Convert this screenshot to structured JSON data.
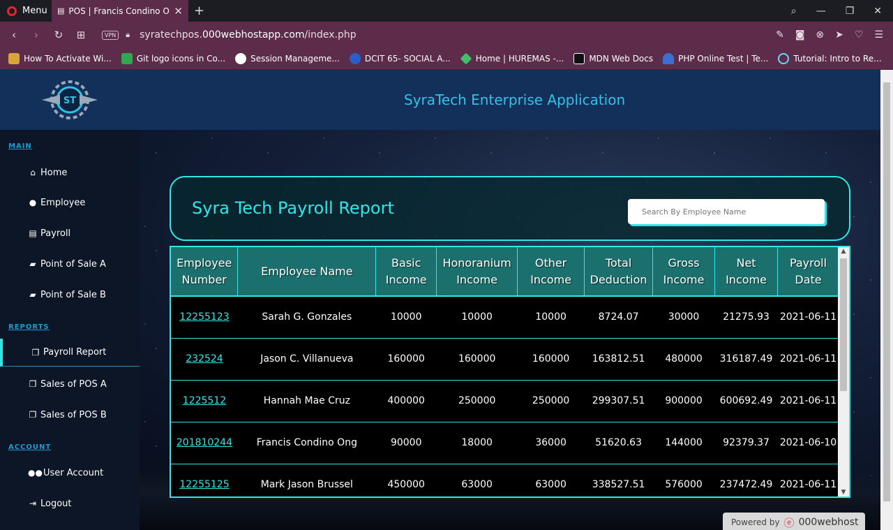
{
  "browser": {
    "menu_label": "Menu",
    "tab_title": "POS | Francis Condino Ong",
    "new_tab": "+",
    "url_prefix": "syratechpos.",
    "url_domain": "000webhostapp.com",
    "url_path": "/index.php",
    "vpn_label": "VPN",
    "bookmarks": [
      {
        "label": "How To Activate Wi...",
        "color": "#d9a43a"
      },
      {
        "label": "Git logo icons in Co...",
        "color": "#2fa84f"
      },
      {
        "label": "Session Manageme...",
        "color": "#ffffff"
      },
      {
        "label": "DCIT 65- SOCIAL A...",
        "color": "#2a5ec9"
      },
      {
        "label": "Home | HUREMAS -...",
        "color": "#3fbf6a"
      },
      {
        "label": "MDN Web Docs",
        "color": "#111111"
      },
      {
        "label": "PHP Online Test | Te...",
        "color": "#3b6fd1"
      },
      {
        "label": "Tutorial: Intro to Re...",
        "color": "#61dafb"
      }
    ]
  },
  "header": {
    "app_title": "SyraTech Enterprise Application"
  },
  "sidebar": {
    "main_title": "MAIN",
    "main_items": [
      {
        "label": "Home",
        "icon": "home-icon"
      },
      {
        "label": "Employee",
        "icon": "user-icon"
      },
      {
        "label": "Payroll",
        "icon": "file-icon"
      },
      {
        "label": "Point of Sale A",
        "icon": "cash-icon"
      },
      {
        "label": "Point of Sale B",
        "icon": "cash-icon"
      }
    ],
    "reports_title": "REPORTS",
    "reports_items": [
      {
        "label": "Payroll Report",
        "icon": "copy-icon"
      },
      {
        "label": "Sales of POS A",
        "icon": "copy-icon"
      },
      {
        "label": "Sales of POS B",
        "icon": "copy-icon"
      }
    ],
    "account_title": "ACCOUNT",
    "account_items": [
      {
        "label": "User Account",
        "icon": "users-icon"
      },
      {
        "label": "Logout",
        "icon": "logout-icon"
      }
    ]
  },
  "report": {
    "title": "Syra Tech Payroll Report",
    "search_placeholder": "Search By Employee Name"
  },
  "table": {
    "headers": [
      [
        "Employee",
        "Number"
      ],
      [
        "Employee Name",
        ""
      ],
      [
        "Basic",
        "Income"
      ],
      [
        "Honoranium",
        "Income"
      ],
      [
        "Other",
        "Income"
      ],
      [
        "Total",
        "Deduction"
      ],
      [
        "Gross",
        "Income"
      ],
      [
        "Net",
        "Income"
      ],
      [
        "Payroll",
        "Date"
      ]
    ],
    "rows": [
      [
        "12255123",
        "Sarah G. Gonzales",
        "10000",
        "10000",
        "10000",
        "8724.07",
        "30000",
        "21275.93",
        "2021-06-11"
      ],
      [
        "232524",
        "Jason C. Villanueva",
        "160000",
        "160000",
        "160000",
        "163812.51",
        "480000",
        "316187.49",
        "2021-06-11"
      ],
      [
        "1225512",
        "Hannah Mae Cruz",
        "400000",
        "250000",
        "250000",
        "299307.51",
        "900000",
        "600692.49",
        "2021-06-11"
      ],
      [
        "201810244",
        "Francis Condino Ong",
        "90000",
        "18000",
        "36000",
        "51620.63",
        "144000",
        "92379.37",
        "2021-06-10"
      ],
      [
        "12255125",
        "Mark Jason Brussel",
        "450000",
        "63000",
        "63000",
        "338527.51",
        "576000",
        "237472.49",
        "2021-06-11"
      ]
    ]
  },
  "footer": {
    "powered_by": "Powered by",
    "host": "000webhost"
  }
}
